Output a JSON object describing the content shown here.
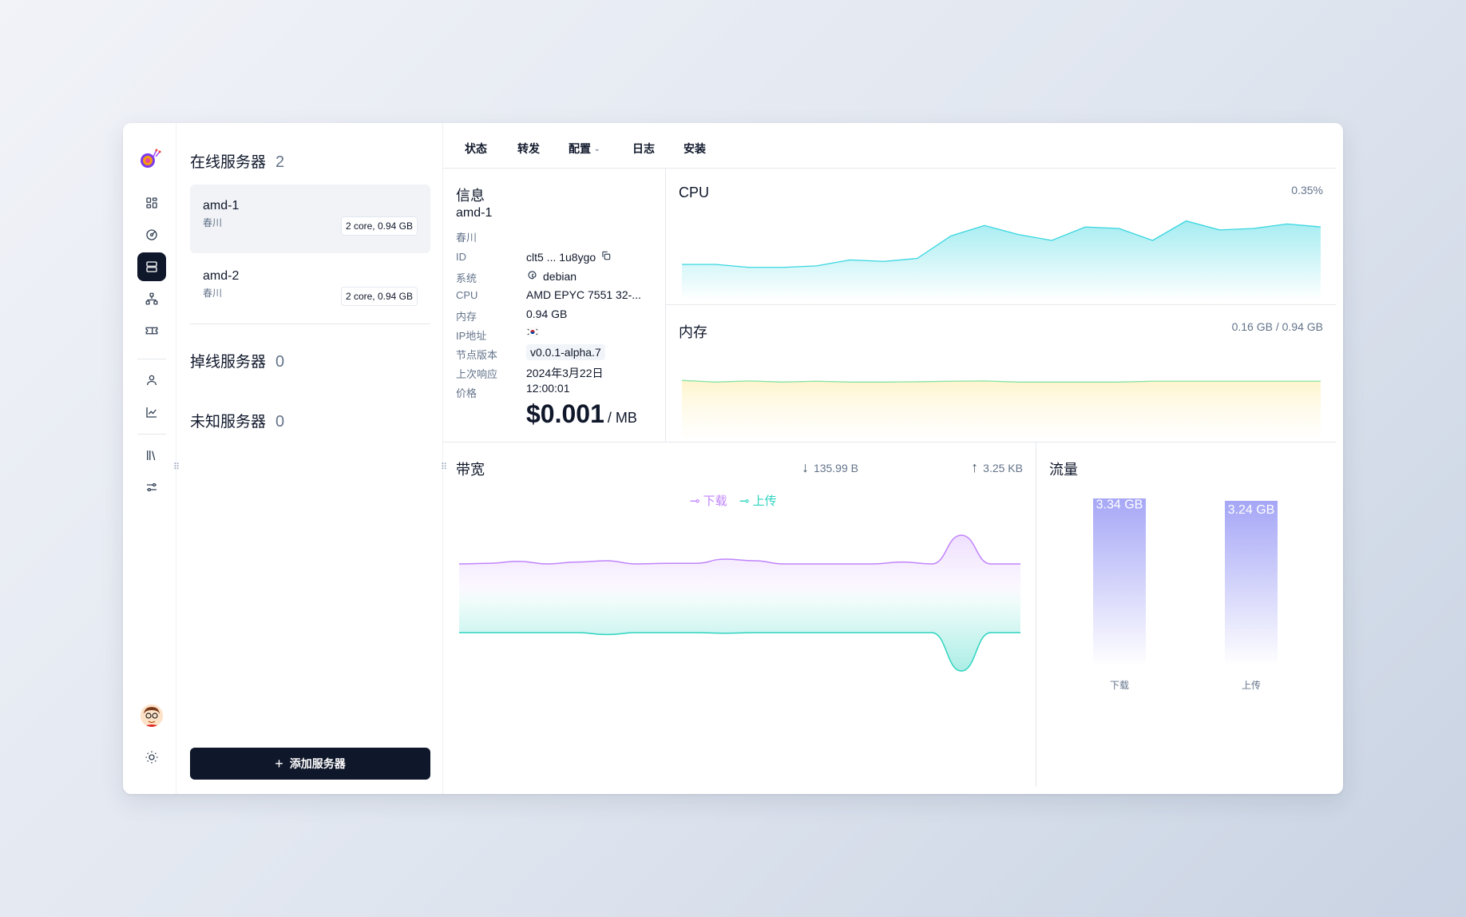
{
  "sidebar": {
    "icons": [
      "snail-logo",
      "dashboard-icon",
      "gauge-icon",
      "server-icon",
      "network-icon",
      "ticket-icon",
      "user-icon",
      "chart-line-icon",
      "library-icon",
      "sliders-icon"
    ],
    "active": "server-icon"
  },
  "server_list": {
    "online": {
      "label": "在线服务器",
      "count": "2"
    },
    "servers": [
      {
        "name": "amd-1",
        "location": "春川",
        "spec": "2 core, 0.94 GB"
      },
      {
        "name": "amd-2",
        "location": "春川",
        "spec": "2 core, 0.94 GB"
      }
    ],
    "offline": {
      "label": "掉线服务器",
      "count": "0"
    },
    "unknown": {
      "label": "未知服务器",
      "count": "0"
    },
    "add_button": "添加服务器"
  },
  "tabs": {
    "status": "状态",
    "forward": "转发",
    "config": "配置",
    "logs": "日志",
    "install": "安装"
  },
  "info": {
    "title": "信息",
    "name": "amd-1",
    "location": "春川",
    "rows": [
      {
        "key": "ID",
        "value": "clt5 ... 1u8ygo"
      },
      {
        "key": "系统",
        "value": "debian"
      },
      {
        "key": "CPU",
        "value": "AMD EPYC 7551 32-..."
      },
      {
        "key": "内存",
        "value": "0.94 GB"
      },
      {
        "key": "IP地址",
        "value": ""
      },
      {
        "key": "节点版本",
        "value": "v0.0.1-alpha.7"
      },
      {
        "key": "上次响应",
        "value": "2024年3月22日"
      },
      {
        "key": "价格",
        "value": "12:00:01"
      }
    ],
    "price": "$0.001",
    "price_unit": "/ MB"
  },
  "cpu": {
    "title": "CPU",
    "value": "0.35%"
  },
  "memory": {
    "title": "内存",
    "value": "0.16 GB / 0.94 GB"
  },
  "bandwidth": {
    "title": "带宽",
    "download": "135.99 B",
    "upload": "3.25 KB",
    "legend_download": "下载",
    "legend_upload": "上传"
  },
  "traffic": {
    "title": "流量"
  },
  "colors": {
    "cpu": "#38d6e0",
    "memory": "#86e3a3",
    "download": "#c084fc",
    "upload": "#2dd4bf",
    "bar": "#a5a6f6",
    "delete": "#ef4444"
  },
  "chart_data": [
    {
      "type": "area",
      "title": "CPU",
      "series": [
        {
          "values": [
            0.08,
            0.08,
            0.06,
            0.06,
            0.07,
            0.11,
            0.1,
            0.12,
            0.27,
            0.34,
            0.28,
            0.24,
            0.33,
            0.32,
            0.24,
            0.37,
            0.31,
            0.32,
            0.35,
            0.33
          ]
        }
      ]
    },
    {
      "type": "area",
      "title": "内存",
      "series": [
        {
          "values": [
            0.168,
            0.162,
            0.166,
            0.162,
            0.165,
            0.162,
            0.162,
            0.163,
            0.165,
            0.166,
            0.162,
            0.162,
            0.162,
            0.162,
            0.165,
            0.165,
            0.165,
            0.165,
            0.165,
            0.165
          ]
        }
      ]
    },
    {
      "type": "area",
      "title": "带宽",
      "series": [
        {
          "name": "下载",
          "values": [
            0.1,
            0.12,
            0.18,
            0.1,
            0.16,
            0.2,
            0.1,
            0.12,
            0.12,
            0.25,
            0.2,
            0.1,
            0.1,
            0.1,
            0.1,
            0.16,
            0.1,
            1.0,
            0.1,
            0.1
          ]
        },
        {
          "name": "上传",
          "values": [
            0.1,
            0.1,
            0.1,
            0.1,
            0.1,
            0.16,
            0.1,
            0.1,
            0.1,
            0.12,
            0.1,
            0.1,
            0.1,
            0.1,
            0.1,
            0.1,
            0.1,
            1.3,
            0.1,
            0.1
          ]
        }
      ]
    },
    {
      "type": "bar",
      "title": "流量",
      "categories": [
        "下载",
        "上传"
      ],
      "values": [
        3.34,
        3.24
      ],
      "labels": [
        "3.34 GB",
        "3.24 GB"
      ],
      "unit": "GB"
    }
  ]
}
